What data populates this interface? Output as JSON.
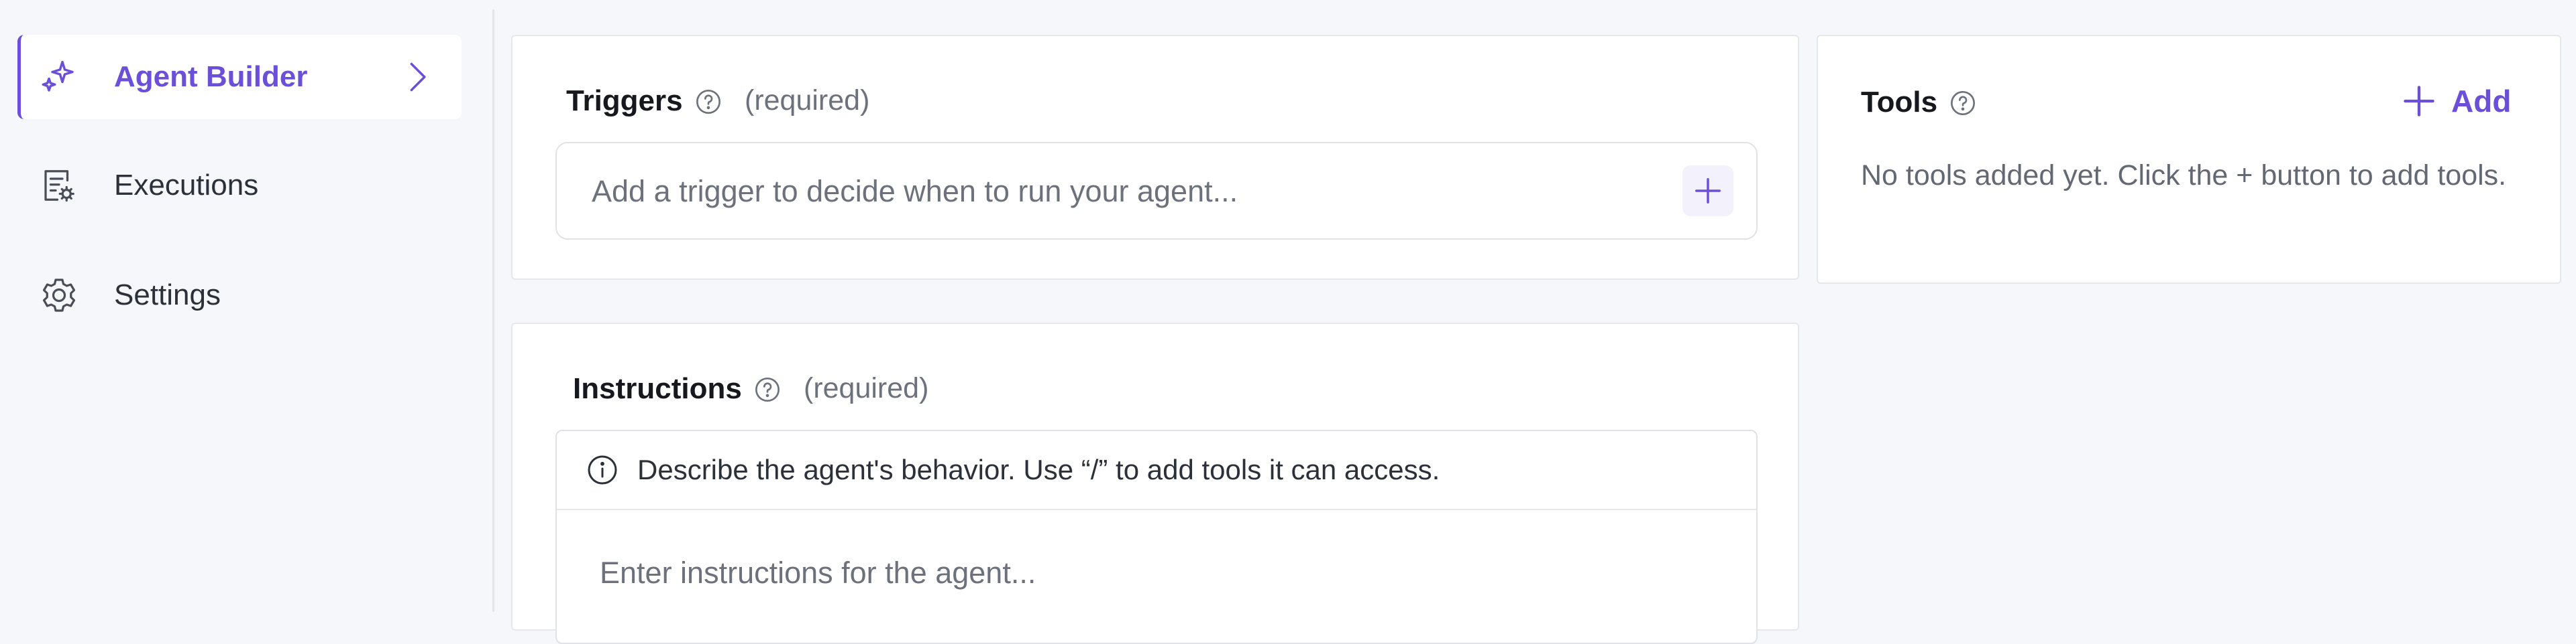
{
  "sidebar": {
    "items": [
      {
        "label": "Agent Builder",
        "icon": "sparkle-icon",
        "active": true
      },
      {
        "label": "Executions",
        "icon": "executions-icon",
        "active": false
      },
      {
        "label": "Settings",
        "icon": "gear-icon",
        "active": false
      }
    ]
  },
  "triggers": {
    "title": "Triggers",
    "required": "(required)",
    "placeholder": "Add a trigger to decide when to run your agent..."
  },
  "tools": {
    "title": "Tools",
    "add_label": "Add",
    "empty_text": "No tools added yet. Click the + button to add tools."
  },
  "instructions": {
    "title": "Instructions",
    "required": "(required)",
    "hint": "Describe the agent's behavior. Use “/” to add tools it can access.",
    "placeholder": "Enter instructions for the agent..."
  },
  "colors": {
    "accent": "#6b4fd8",
    "background": "#f6f7fb",
    "card": "#ffffff",
    "border": "#e5e7ec"
  }
}
